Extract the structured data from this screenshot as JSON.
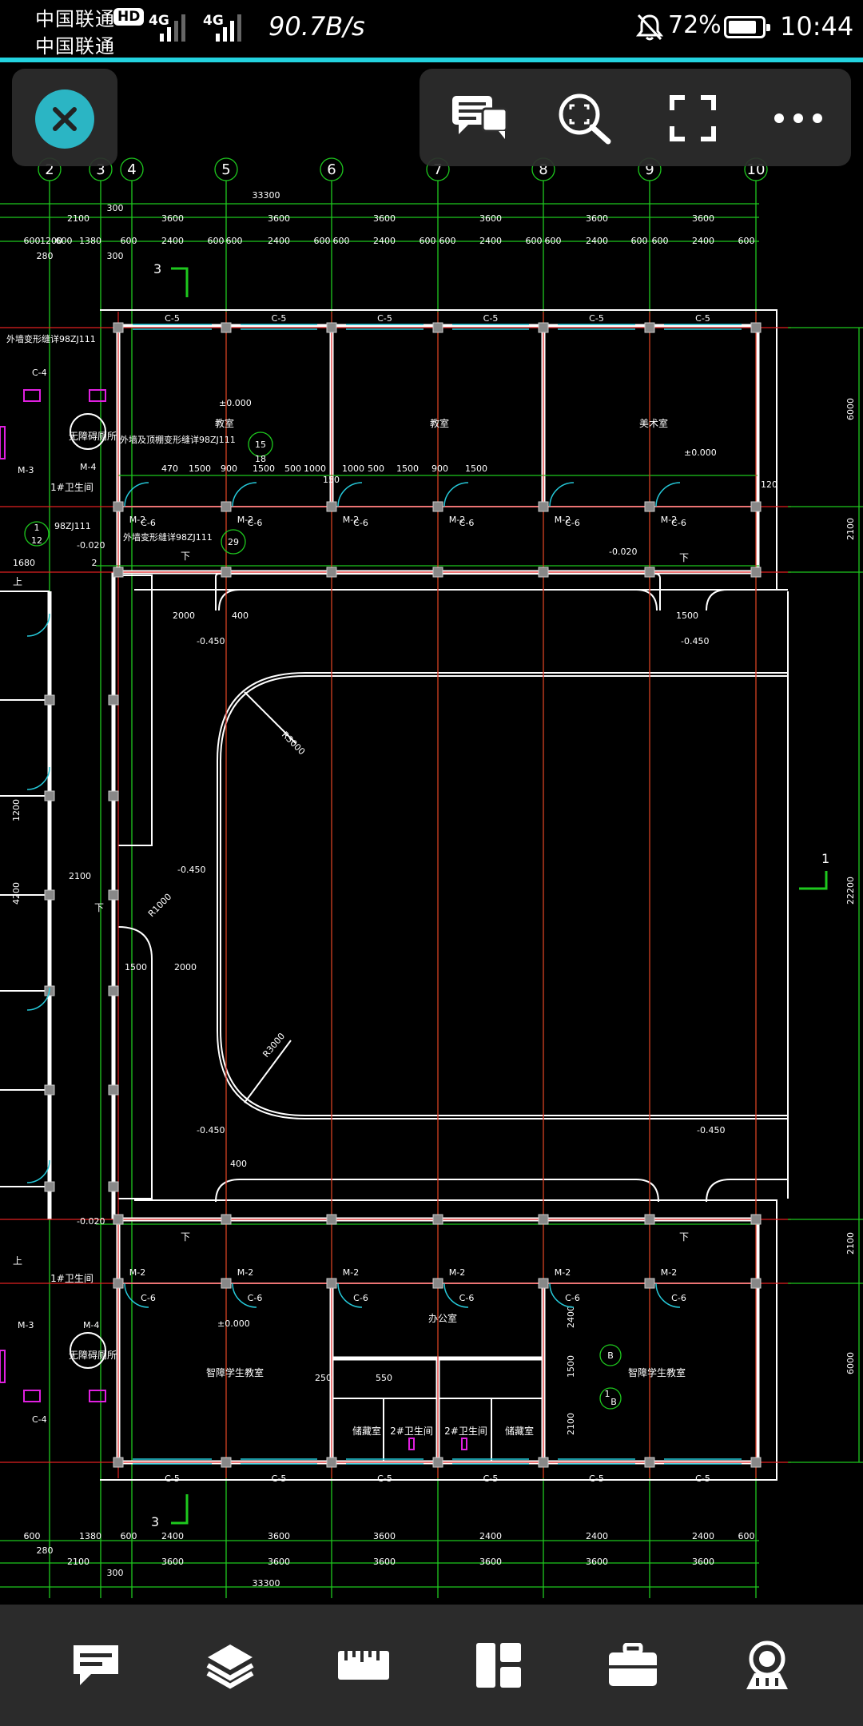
{
  "status_bar": {
    "carrier_1": "中国联通",
    "carrier_2": "中国联通",
    "hd_badge": "HD",
    "signal_1": "4G",
    "signal_2": "4G",
    "net_speed": "90.7B/s",
    "battery_percent": "72%",
    "time": "10:44",
    "icons": [
      "hd-icon",
      "signal-icon",
      "mute-bell-icon",
      "battery-icon"
    ]
  },
  "toolbar_top": {
    "close_icon": "close-icon",
    "buttons": [
      "comment-icon",
      "zoom-extents-icon",
      "fullscreen-icon",
      "more-icon"
    ]
  },
  "bottom_toolbar": {
    "buttons": [
      "annotation-icon",
      "layers-icon",
      "measure-icon",
      "layout-icon",
      "toolbox-icon",
      "account-icon"
    ]
  },
  "drawing": {
    "axis_labels": [
      "2",
      "3",
      "4",
      "5",
      "6",
      "7",
      "8",
      "9",
      "10"
    ],
    "total_width": "33300",
    "top_dims": [
      "2100",
      "300",
      "3600",
      "3600",
      "3600",
      "3600",
      "3600",
      "3600"
    ],
    "sub_dims": [
      "600",
      "1200",
      "600",
      "1380",
      "600",
      "2400",
      "600",
      "600",
      "2400",
      "600",
      "600",
      "2400",
      "600",
      "600",
      "2400",
      "600",
      "600",
      "2400",
      "600",
      "600",
      "2400",
      "600",
      "600",
      "2400",
      "600"
    ],
    "small_dims": [
      "280",
      "300"
    ],
    "section_marks": [
      "3",
      "3",
      "1"
    ],
    "window_tags": [
      "C-5",
      "C-4",
      "C-6"
    ],
    "door_tags": [
      "M-2",
      "M-3",
      "M-4"
    ],
    "rooms": [
      "教室",
      "教室",
      "美术室",
      "智障学生教室",
      "智障学生教室",
      "办公室",
      "储藏室",
      "2#卫生间",
      "2#卫生间",
      "储藏室",
      "1#卫生间",
      "1#卫生间",
      "无障碍厕所",
      "无障碍厕所"
    ],
    "elevations": [
      "±0.000",
      "±0.000",
      "-0.020",
      "-0.020",
      "-0.020",
      "-0.450",
      "-0.450",
      "-0.450",
      "-0.450",
      "-0.450"
    ],
    "notes": [
      "外墙变形缝详98ZJ111",
      "外墙及顶棚变形缝详98ZJ111",
      "外墙变形缝详98ZJ111",
      "98ZJ111"
    ],
    "detail_refs": [
      "15",
      "18",
      "29",
      "1",
      "12",
      "2",
      "B",
      "1",
      "B"
    ],
    "radii": [
      "R3000",
      "R3000",
      "R1000"
    ],
    "inner_dims": [
      "470",
      "1500",
      "900",
      "1500",
      "500",
      "1000",
      "500",
      "1000",
      "1500",
      "900",
      "1500",
      "120",
      "150",
      "1000",
      "2000",
      "400",
      "1500",
      "1680",
      "2100",
      "1200",
      "4200",
      "1500",
      "2000",
      "400",
      "2400",
      "1500",
      "2100",
      "250",
      "550"
    ],
    "right_dims": [
      "6000",
      "2100",
      "22200",
      "2100",
      "6000"
    ],
    "stair_marks": [
      "上",
      "上",
      "下",
      "下",
      "下",
      "下",
      "下"
    ]
  }
}
